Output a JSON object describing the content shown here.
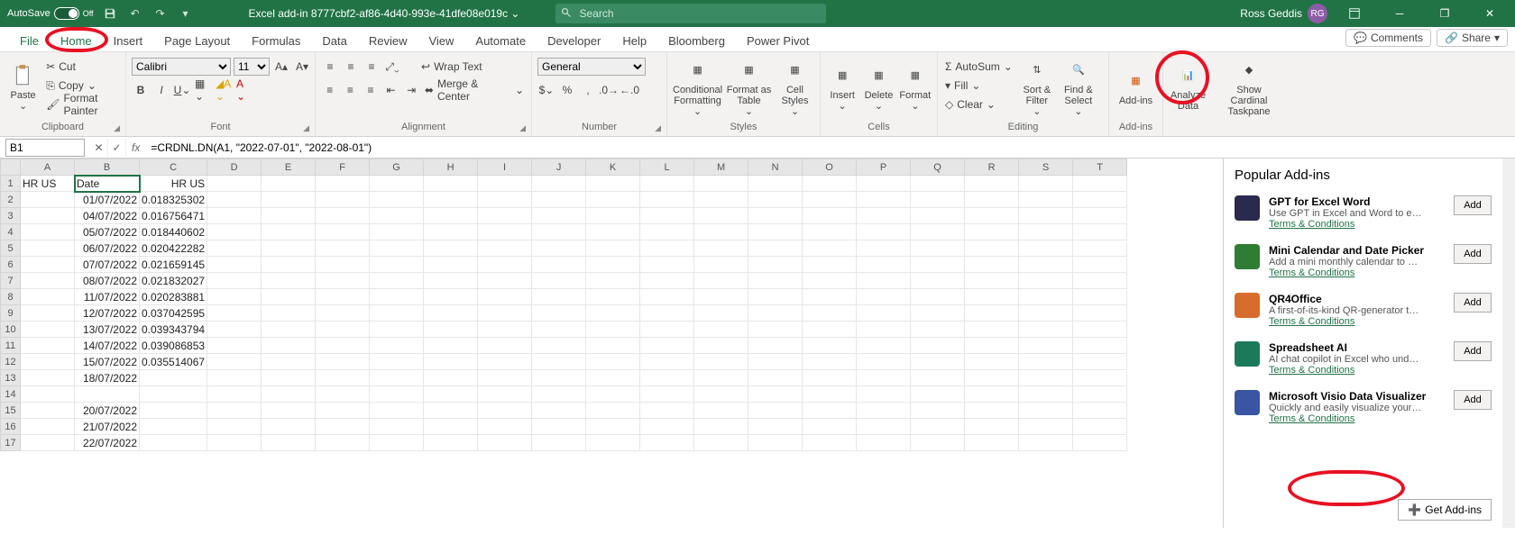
{
  "titlebar": {
    "autosave_label": "AutoSave",
    "autosave_state": "Off",
    "filename": "Excel add-in 8777cbf2-af86-4d40-993e-41dfe08e019c ⌄",
    "search_placeholder": "Search",
    "user_name": "Ross Geddis",
    "user_initials": "RG"
  },
  "tabs": {
    "file": "File",
    "items": [
      "Home",
      "Insert",
      "Page Layout",
      "Formulas",
      "Data",
      "Review",
      "View",
      "Automate",
      "Developer",
      "Help",
      "Bloomberg",
      "Power Pivot"
    ],
    "active_index": 0,
    "comments": "Comments",
    "share": "Share"
  },
  "ribbon": {
    "clipboard": {
      "label": "Clipboard",
      "paste": "Paste",
      "cut": "Cut",
      "copy": "Copy",
      "format_painter": "Format Painter"
    },
    "font": {
      "label": "Font",
      "name": "Calibri",
      "size": "11"
    },
    "alignment": {
      "label": "Alignment",
      "wrap": "Wrap Text",
      "merge": "Merge & Center"
    },
    "number": {
      "label": "Number",
      "format": "General"
    },
    "styles": {
      "label": "Styles",
      "cond": "Conditional Formatting",
      "table": "Format as Table",
      "cell": "Cell Styles"
    },
    "cells": {
      "label": "Cells",
      "insert": "Insert",
      "delete": "Delete",
      "format": "Format"
    },
    "editing": {
      "label": "Editing",
      "autosum": "AutoSum",
      "fill": "Fill",
      "clear": "Clear",
      "sort": "Sort & Filter",
      "find": "Find & Select"
    },
    "addins": {
      "label": "Add-ins",
      "addins_btn": "Add-ins"
    },
    "analyze": "Analyze Data",
    "taskpane": "Show Cardinal Taskpane"
  },
  "formula_bar": {
    "name_box": "B1",
    "formula": "=CRDNL.DN(A1, \"2022-07-01\", \"2022-08-01\")"
  },
  "grid": {
    "columns": [
      "A",
      "B",
      "C",
      "D",
      "E",
      "F",
      "G",
      "H",
      "I",
      "J",
      "K",
      "L",
      "M",
      "N",
      "O",
      "P",
      "Q",
      "R",
      "S",
      "T"
    ],
    "rows": [
      [
        "HR US",
        "Date",
        "HR US",
        "",
        "",
        "",
        "",
        "",
        "",
        "",
        "",
        "",
        "",
        "",
        "",
        "",
        "",
        "",
        "",
        ""
      ],
      [
        "",
        "01/07/2022",
        "0.018325302",
        "",
        "",
        "",
        "",
        "",
        "",
        "",
        "",
        "",
        "",
        "",
        "",
        "",
        "",
        "",
        "",
        ""
      ],
      [
        "",
        "04/07/2022",
        "0.016756471",
        "",
        "",
        "",
        "",
        "",
        "",
        "",
        "",
        "",
        "",
        "",
        "",
        "",
        "",
        "",
        "",
        ""
      ],
      [
        "",
        "05/07/2022",
        "0.018440602",
        "",
        "",
        "",
        "",
        "",
        "",
        "",
        "",
        "",
        "",
        "",
        "",
        "",
        "",
        "",
        "",
        ""
      ],
      [
        "",
        "06/07/2022",
        "0.020422282",
        "",
        "",
        "",
        "",
        "",
        "",
        "",
        "",
        "",
        "",
        "",
        "",
        "",
        "",
        "",
        "",
        ""
      ],
      [
        "",
        "07/07/2022",
        "0.021659145",
        "",
        "",
        "",
        "",
        "",
        "",
        "",
        "",
        "",
        "",
        "",
        "",
        "",
        "",
        "",
        "",
        ""
      ],
      [
        "",
        "08/07/2022",
        "0.021832027",
        "",
        "",
        "",
        "",
        "",
        "",
        "",
        "",
        "",
        "",
        "",
        "",
        "",
        "",
        "",
        "",
        ""
      ],
      [
        "",
        "11/07/2022",
        "0.020283881",
        "",
        "",
        "",
        "",
        "",
        "",
        "",
        "",
        "",
        "",
        "",
        "",
        "",
        "",
        "",
        "",
        ""
      ],
      [
        "",
        "12/07/2022",
        "0.037042595",
        "",
        "",
        "",
        "",
        "",
        "",
        "",
        "",
        "",
        "",
        "",
        "",
        "",
        "",
        "",
        "",
        ""
      ],
      [
        "",
        "13/07/2022",
        "0.039343794",
        "",
        "",
        "",
        "",
        "",
        "",
        "",
        "",
        "",
        "",
        "",
        "",
        "",
        "",
        "",
        "",
        ""
      ],
      [
        "",
        "14/07/2022",
        "0.039086853",
        "",
        "",
        "",
        "",
        "",
        "",
        "",
        "",
        "",
        "",
        "",
        "",
        "",
        "",
        "",
        "",
        ""
      ],
      [
        "",
        "15/07/2022",
        "0.035514067",
        "",
        "",
        "",
        "",
        "",
        "",
        "",
        "",
        "",
        "",
        "",
        "",
        "",
        "",
        "",
        "",
        ""
      ],
      [
        "",
        "18/07/2022",
        "",
        "",
        "",
        "",
        "",
        "",
        "",
        "",
        "",
        "",
        "",
        "",
        "",
        "",
        "",
        "",
        "",
        ""
      ],
      [
        "",
        "",
        "",
        "",
        "",
        "",
        "",
        "",
        "",
        "",
        "",
        "",
        "",
        "",
        "",
        "",
        "",
        "",
        "",
        ""
      ],
      [
        "",
        "20/07/2022",
        "",
        "",
        "",
        "",
        "",
        "",
        "",
        "",
        "",
        "",
        "",
        "",
        "",
        "",
        "",
        "",
        "",
        ""
      ],
      [
        "",
        "21/07/2022",
        "",
        "",
        "",
        "",
        "",
        "",
        "",
        "",
        "",
        "",
        "",
        "",
        "",
        "",
        "",
        "",
        "",
        ""
      ],
      [
        "",
        "22/07/2022",
        "",
        "",
        "",
        "",
        "",
        "",
        "",
        "",
        "",
        "",
        "",
        "",
        "",
        "",
        "",
        "",
        "",
        ""
      ]
    ],
    "selected": "B1"
  },
  "pane": {
    "title": "Popular Add-ins",
    "items": [
      {
        "name": "GPT for Excel Word",
        "desc": "Use GPT in Excel and Word to edit,…",
        "terms": "Terms & Conditions",
        "ico": "#2a2a4e"
      },
      {
        "name": "Mini Calendar and Date Picker",
        "desc": "Add a mini monthly calendar to yo…",
        "terms": "Terms & Conditions",
        "ico": "#2e7d32"
      },
      {
        "name": "QR4Office",
        "desc": "A first-of-its-kind QR-generator tha…",
        "terms": "Terms & Conditions",
        "ico": "#d86c2c"
      },
      {
        "name": "Spreadsheet AI",
        "desc": "AI chat copilot in Excel who unders…",
        "terms": "Terms & Conditions",
        "ico": "#1b7a5a"
      },
      {
        "name": "Microsoft Visio Data Visualizer",
        "desc": "Quickly and easily visualize your da…",
        "terms": "Terms & Conditions",
        "ico": "#3955a3"
      }
    ],
    "add_label": "Add",
    "get_addins": "Get Add-ins"
  }
}
